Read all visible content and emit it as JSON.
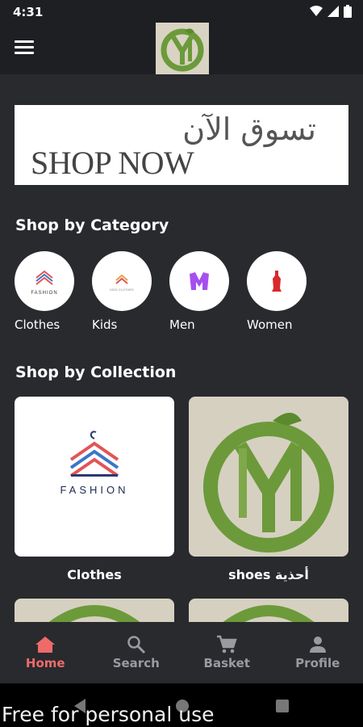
{
  "status_bar": {
    "time": "4:31"
  },
  "banner": {
    "arabic_text": "تسوق الآن",
    "english_text": "SHOP NOW"
  },
  "categories": {
    "title": "Shop by Category",
    "items": [
      {
        "label": "Clothes",
        "logo_text": "FASHION"
      },
      {
        "label": "Kids",
        "logo_text": "KIDS CLOTHES"
      },
      {
        "label": "Men"
      },
      {
        "label": "Women"
      }
    ]
  },
  "collections": {
    "title": "Shop by Collection",
    "items": [
      {
        "label": "Clothes",
        "logo_text": "FASHION"
      },
      {
        "label": "shoes أحذية"
      }
    ]
  },
  "bottom_nav": {
    "items": [
      {
        "label": "Home",
        "icon": "home-icon",
        "active": true
      },
      {
        "label": "Search",
        "icon": "search-icon",
        "active": false
      },
      {
        "label": "Basket",
        "icon": "cart-icon",
        "active": false
      },
      {
        "label": "Profile",
        "icon": "person-icon",
        "active": false
      }
    ]
  },
  "watermark": "Free for personal use",
  "colors": {
    "accent": "#f06a6a",
    "inactive": "#9a9aa0",
    "background": "#292a2e",
    "appbar": "#1e1f23"
  }
}
